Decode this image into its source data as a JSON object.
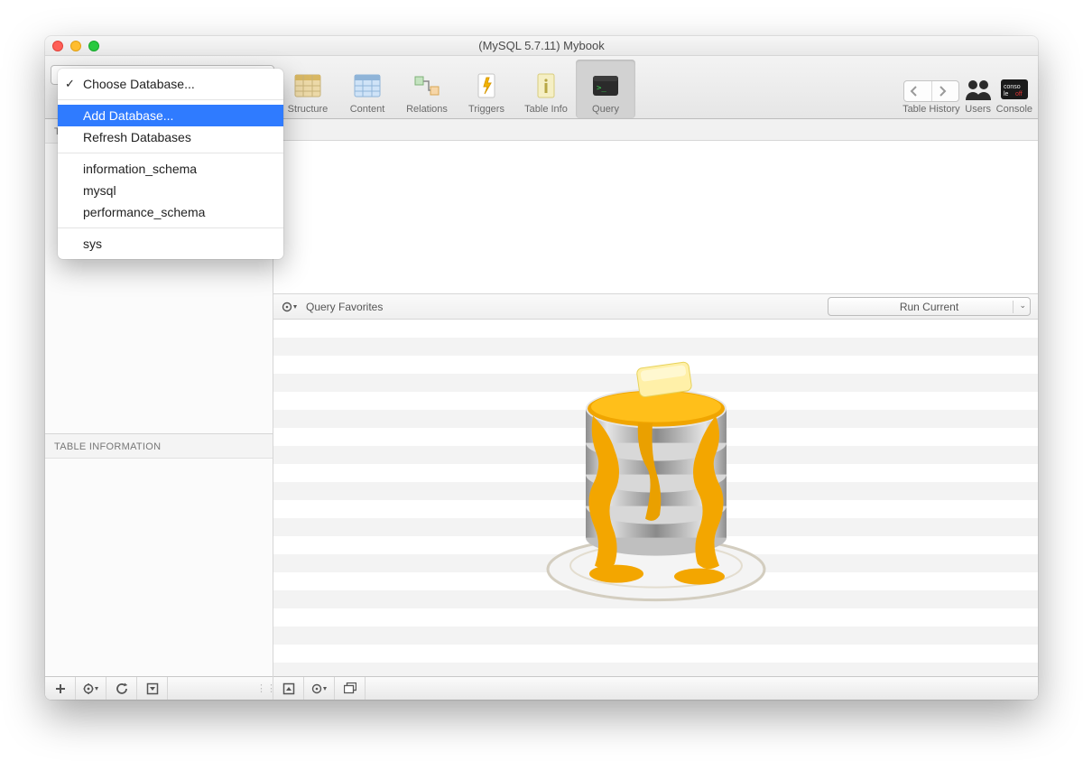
{
  "titlebar": {
    "title": "(MySQL 5.7.11) Mybook"
  },
  "toolbar": {
    "tabs": [
      {
        "label": "Structure"
      },
      {
        "label": "Content"
      },
      {
        "label": "Relations"
      },
      {
        "label": "Triggers"
      },
      {
        "label": "Table Info"
      },
      {
        "label": "Query"
      }
    ],
    "history_label": "Table History",
    "users_label": "Users",
    "console_label": "Console"
  },
  "dropdown": {
    "choose": "Choose Database...",
    "add": "Add Database...",
    "refresh": "Refresh Databases",
    "dbs": [
      "information_schema",
      "mysql",
      "performance_schema"
    ],
    "dbs2": [
      "sys"
    ]
  },
  "sidebar": {
    "tables_head": "TABLES",
    "info_head": "TABLE INFORMATION"
  },
  "querybar": {
    "favorites_label": "Query Favorites",
    "run_label": "Run Current"
  }
}
